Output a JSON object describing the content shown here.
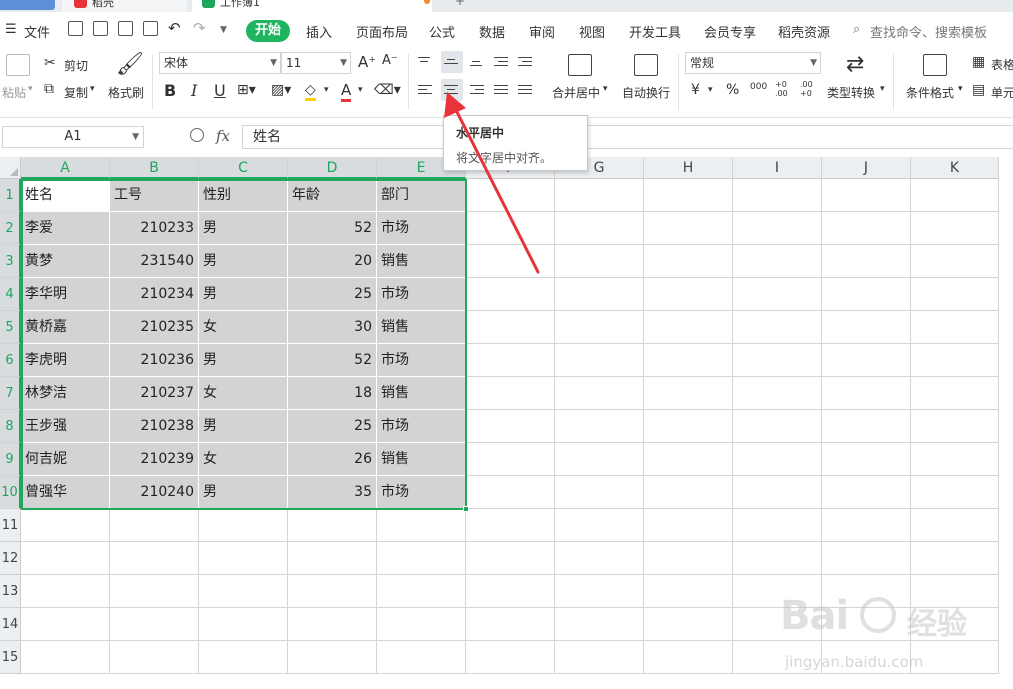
{
  "tabs": {
    "pdf_label": "稻壳",
    "sheet_label": "工作簿1"
  },
  "menu": {
    "file": "文件",
    "items": [
      "开始",
      "插入",
      "页面布局",
      "公式",
      "数据",
      "审阅",
      "视图",
      "开发工具",
      "会员专享",
      "稻壳资源"
    ],
    "search": "查找命令、搜索模板"
  },
  "ribbon": {
    "paste": "粘贴",
    "cut": "剪切",
    "copy": "复制",
    "format_painter": "格式刷",
    "font_name": "宋体",
    "font_size": "11",
    "bold": "B",
    "italic": "I",
    "underline": "U",
    "merge_center": "合并居中",
    "wrap_text": "自动换行",
    "number_format": "常规",
    "currency": "¥",
    "percent": "%",
    "thousands": "000",
    "dec_inc": "+0 .00",
    "dec_dec": ".00 +0",
    "type_convert": "类型转换",
    "cond_format": "条件格式",
    "table_style": "表格",
    "cell_style": "单元"
  },
  "tooltip": {
    "title": "水平居中",
    "desc": "将文字居中对齐。"
  },
  "formula_bar": {
    "name_box": "A1",
    "fx": "fx",
    "content": "姓名"
  },
  "grid": {
    "columns": [
      "A",
      "B",
      "C",
      "D",
      "E",
      "F",
      "G",
      "H",
      "I",
      "J",
      "K"
    ],
    "row_numbers": [
      "1",
      "2",
      "3",
      "4",
      "5",
      "6",
      "7",
      "8",
      "9",
      "10",
      "11",
      "12",
      "13",
      "14",
      "15"
    ],
    "header_row": [
      "姓名",
      "工号",
      "性别",
      "年龄",
      "部门"
    ],
    "rows": [
      [
        "李爱",
        "210233",
        "男",
        "52",
        "市场"
      ],
      [
        "黄梦",
        "231540",
        "男",
        "20",
        "销售"
      ],
      [
        "李华明",
        "210234",
        "男",
        "25",
        "市场"
      ],
      [
        "黄桥嘉",
        "210235",
        "女",
        "30",
        "销售"
      ],
      [
        "李虎明",
        "210236",
        "男",
        "52",
        "市场"
      ],
      [
        "林梦洁",
        "210237",
        "女",
        "18",
        "销售"
      ],
      [
        "王步强",
        "210238",
        "男",
        "25",
        "市场"
      ],
      [
        "何吉妮",
        "210239",
        "女",
        "26",
        "销售"
      ],
      [
        "曾强华",
        "210240",
        "男",
        "35",
        "市场"
      ]
    ]
  },
  "watermark": {
    "brand": "Bai",
    "brand_suffix": "经验",
    "url": "jingyan.baidu.com"
  },
  "colors": {
    "accent_green": "#1fa75e",
    "start_pill": "#1fb55e",
    "selection_fill": "#d3d3d3",
    "arrow_red": "#e8333a"
  }
}
